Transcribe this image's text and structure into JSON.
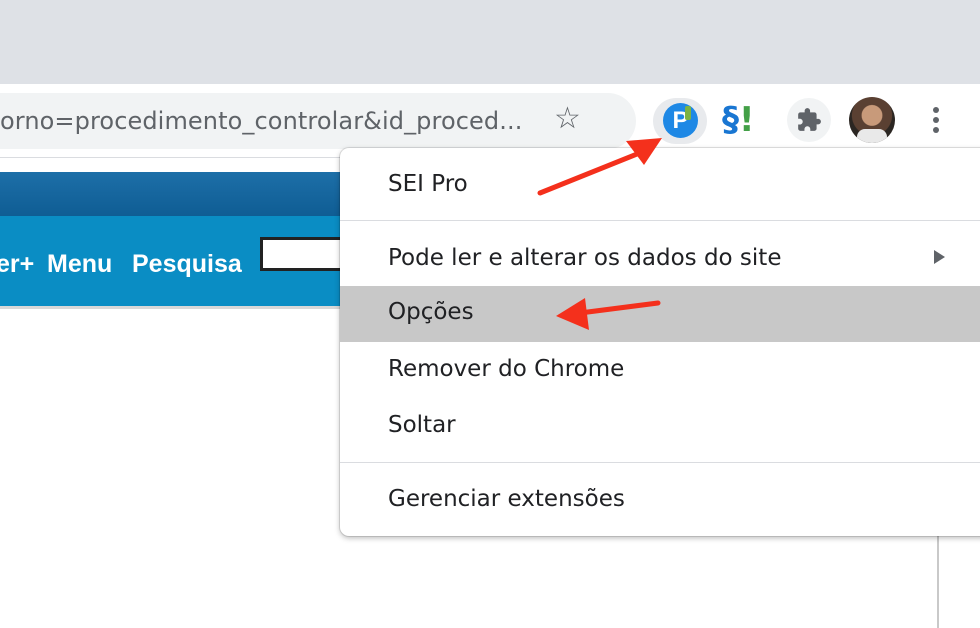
{
  "browser": {
    "address_bar": {
      "url": "orno=procedimento_controlar&id_proced..."
    },
    "star_glyph": "☆",
    "extensions": {
      "sei_pro_glyph": "P",
      "legis_glyph": "§",
      "legis_bang": "!"
    }
  },
  "site": {
    "nav": {
      "item_partial": "er+",
      "menu": "Menu",
      "search": "Pesquisa"
    }
  },
  "context_menu": {
    "title": "SEI Pro",
    "items": [
      {
        "label": "Pode ler e alterar os dados do site",
        "submenu": true
      },
      {
        "label": "Opções",
        "highlighted": true
      },
      {
        "label": "Remover do Chrome"
      },
      {
        "label": "Soltar"
      },
      {
        "label": "Gerenciar extensões"
      }
    ]
  },
  "annotation": {
    "arrow_color": "#f4301c"
  }
}
